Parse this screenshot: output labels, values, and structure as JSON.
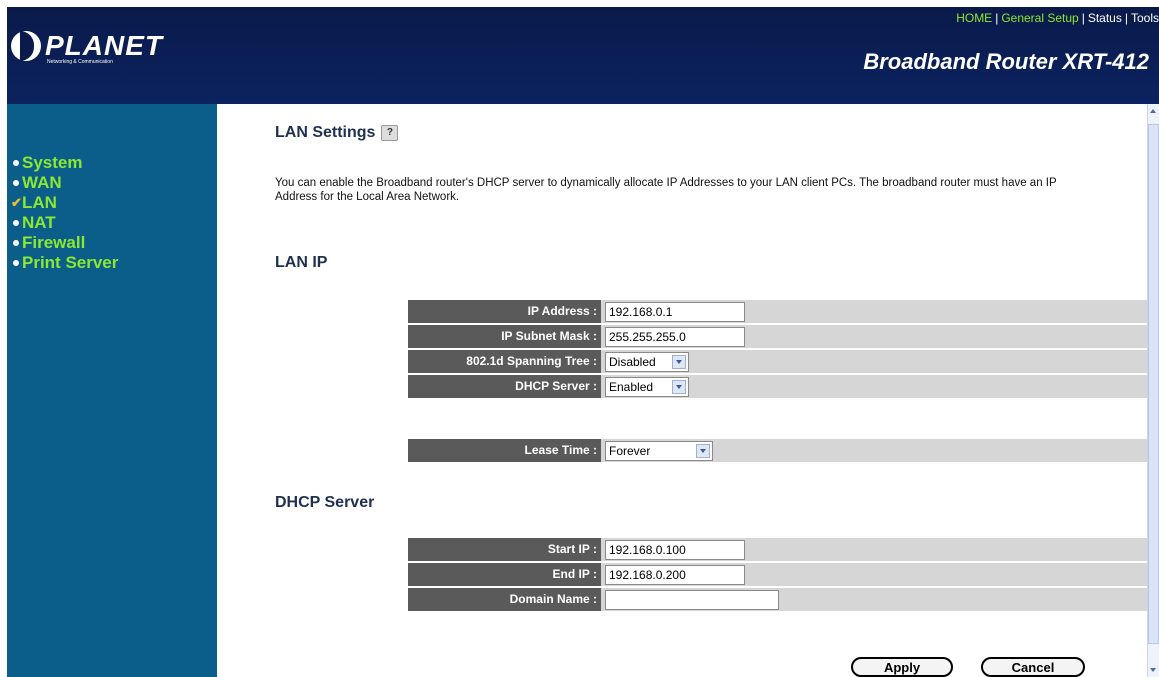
{
  "header": {
    "logo_text": "PLANET",
    "logo_subtitle": "Networking & Communication",
    "product_title": "Broadband Router XRT-412",
    "nav": [
      {
        "label": "HOME",
        "active": true
      },
      {
        "label": "General Setup",
        "active": true
      },
      {
        "label": "Status",
        "active": false
      },
      {
        "label": "Tools",
        "active": false
      }
    ],
    "separator": "|"
  },
  "sidebar": {
    "items": [
      {
        "label": "System",
        "marker": "bullet"
      },
      {
        "label": "WAN",
        "marker": "bullet"
      },
      {
        "label": "LAN",
        "marker": "check"
      },
      {
        "label": "NAT",
        "marker": "bullet"
      },
      {
        "label": "Firewall",
        "marker": "bullet"
      },
      {
        "label": "Print Server",
        "marker": "bullet"
      }
    ]
  },
  "main": {
    "title": "LAN Settings",
    "help_icon": "?",
    "description": "You can enable the Broadband router's DHCP server to dynamically allocate IP Addresses to your LAN client PCs. The broadband router must have an IP Address for the Local Area Network.",
    "lan_ip": {
      "heading": "LAN IP",
      "ip_address_label": "IP Address :",
      "ip_address_value": "192.168.0.1",
      "subnet_label": "IP Subnet Mask :",
      "subnet_value": "255.255.255.0",
      "spanning_label": "802.1d Spanning Tree :",
      "spanning_value": "Disabled",
      "dhcp_label": "DHCP Server :",
      "dhcp_value": "Enabled",
      "lease_label": "Lease Time :",
      "lease_value": "Forever"
    },
    "dhcp_server": {
      "heading": "DHCP Server",
      "start_label": "Start IP :",
      "start_value": "192.168.0.100",
      "end_label": "End IP :",
      "end_value": "192.168.0.200",
      "domain_label": "Domain Name :",
      "domain_value": ""
    },
    "buttons": {
      "apply": "Apply",
      "cancel": "Cancel"
    }
  },
  "colors": {
    "header_bg": "#0a1a4a",
    "sidebar_bg": "#0b5e8a",
    "nav_active": "#8be830",
    "label_bg": "#5a5a5a",
    "row_bg": "#d6d6d6"
  }
}
